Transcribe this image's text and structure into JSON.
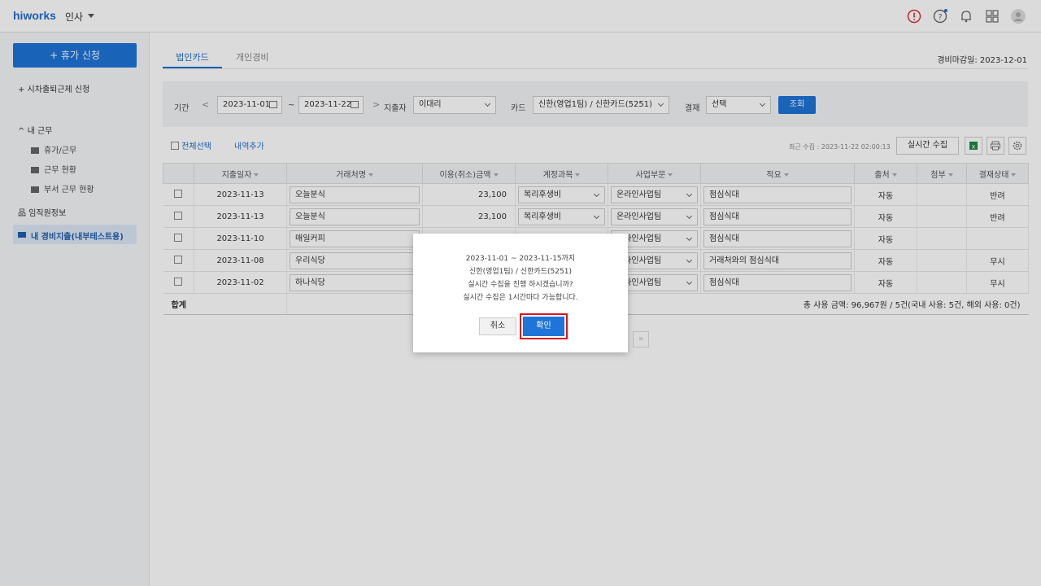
{
  "header": {
    "logo": "hiworks",
    "app": "인사"
  },
  "sidebar": {
    "apply_label": "+ 휴가 신청",
    "attendance": "+  시차출퇴근제 신청",
    "mywork": "内 근무",
    "mywork_label": "내 근무",
    "sub": [
      "휴가/근무",
      "근무 현황",
      "부서 근무 현황"
    ],
    "staff": "임직원정보",
    "expense": "내 경비지출(내부테스트용)"
  },
  "tabs": [
    "법인카드",
    "개인경비"
  ],
  "deadline": "경비마감일: 2023-12-01",
  "filter": {
    "period_label": "기간",
    "start": "2023-11-01",
    "tilde": "~",
    "end": "2023-11-22",
    "spender_label": "지출자",
    "spender": "이대리",
    "card_label": "카드",
    "card": "신한(영업1팀) / 신한카드(5251)",
    "approval_label": "결재",
    "approval": "선택",
    "search": "조회"
  },
  "tools": {
    "select_all": "전체선택",
    "add_row": "내역추가",
    "recent": "최근 수집 : 2023-11-22 02:00:13",
    "realtime": "실시간 수집"
  },
  "table": {
    "headers": [
      "지출일자",
      "거래처명",
      "이용(취소)금액",
      "계정과목",
      "사업부문",
      "적요",
      "출처",
      "첨부",
      "결재상태"
    ],
    "rows": [
      {
        "date": "2023-11-13",
        "vendor": "오늘분식",
        "amount": "23,100",
        "account": "복리후생비",
        "dept": "온라인사업팀",
        "memo": "점심식대",
        "source": "자동",
        "attach": "",
        "status": "반려"
      },
      {
        "date": "2023-11-13",
        "vendor": "오늘분식",
        "amount": "23,100",
        "account": "복리후생비",
        "dept": "온라인사업팀",
        "memo": "점심식대",
        "source": "자동",
        "attach": "",
        "status": "반려"
      },
      {
        "date": "2023-11-10",
        "vendor": "매일커피",
        "amount": "",
        "account": "",
        "dept": "온라인사업팀",
        "memo": "점심식대",
        "source": "자동",
        "attach": "",
        "status": ""
      },
      {
        "date": "2023-11-08",
        "vendor": "우리식당",
        "amount": "",
        "account": "",
        "dept": "온라인사업팀",
        "memo": "거래처와의 점심식대",
        "source": "자동",
        "attach": "",
        "status": "무시"
      },
      {
        "date": "2023-11-02",
        "vendor": "하나식당",
        "amount": "",
        "account": "",
        "dept": "온라인사업팀",
        "memo": "점심식대",
        "source": "자동",
        "attach": "",
        "status": "무시"
      }
    ],
    "sum_label": "합계",
    "sum_text": "총 사용 금액: 96,967원 / 5건(국내 사용: 5건, 해외 사용: 0건)"
  },
  "modal": {
    "lines": [
      "2023-11-01 ~ 2023-11-15까지",
      "신한(영업1팀) / 신한카드(5251)",
      "실시간 수집을 진행 하시겠습니까?",
      "실시간 수집은 1시간마다 가능합니다."
    ],
    "cancel": "취소",
    "ok": "확인"
  },
  "pager_next": "»"
}
